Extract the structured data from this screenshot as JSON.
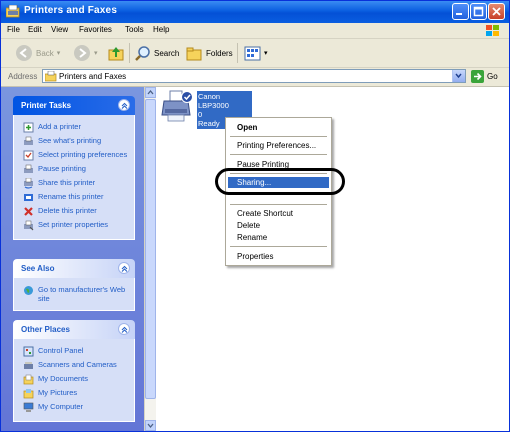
{
  "window": {
    "title": "Printers and Faxes"
  },
  "menu": [
    "File",
    "Edit",
    "View",
    "Favorites",
    "Tools",
    "Help"
  ],
  "toolbar": {
    "back": "Back",
    "search": "Search",
    "folders": "Folders"
  },
  "address": {
    "label": "Address",
    "value": "Printers and Faxes",
    "go": "Go"
  },
  "tasks": {
    "printer_tasks": {
      "title": "Printer Tasks",
      "items": [
        "Add a printer",
        "See what's printing",
        "Select printing preferences",
        "Pause printing",
        "Share this printer",
        "Rename this printer",
        "Delete this printer",
        "Set printer properties"
      ]
    },
    "see_also": {
      "title": "See Also",
      "items": [
        "Go to manufacturer's Web site"
      ]
    },
    "other_places": {
      "title": "Other Places",
      "items": [
        "Control Panel",
        "Scanners and Cameras",
        "My Documents",
        "My Pictures",
        "My Computer"
      ]
    }
  },
  "printer": {
    "name": "Canon LBP3000",
    "docs": "0",
    "status": "Ready"
  },
  "context_menu": {
    "open": "Open",
    "printing_preferences": "Printing Preferences...",
    "pause_printing": "Pause Printing",
    "sharing": "Sharing...",
    "create_shortcut": "Create Shortcut",
    "delete": "Delete",
    "rename": "Rename",
    "properties": "Properties"
  },
  "colors": {
    "title_bar": "#0a5ee0",
    "selection": "#316ac5",
    "task_link": "#215dc6"
  }
}
